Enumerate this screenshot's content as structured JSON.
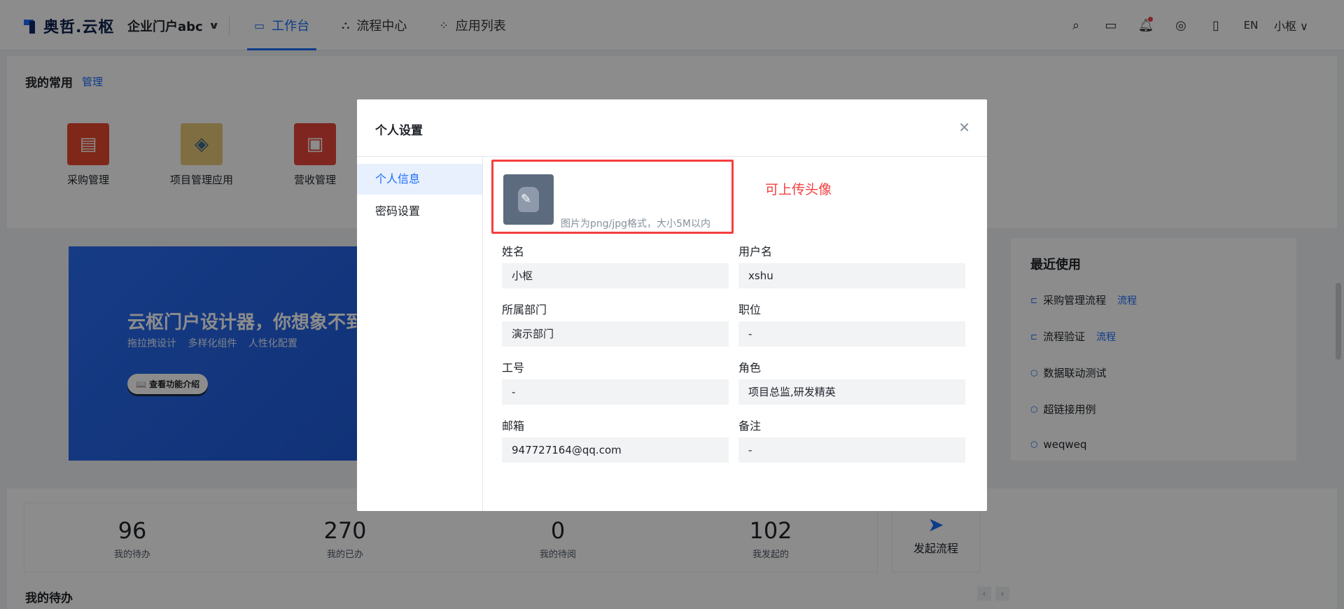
{
  "header": {
    "logo_text": "奥哲.云枢",
    "org_name": "企业门户abc",
    "nav": [
      {
        "label": "工作台",
        "icon": "monitor-icon",
        "active": true
      },
      {
        "label": "流程中心",
        "icon": "flow-icon",
        "active": false
      },
      {
        "label": "应用列表",
        "icon": "grid-icon",
        "active": false
      }
    ],
    "lang": "EN",
    "user_name": "小枢"
  },
  "favorites": {
    "title": "我的常用",
    "manage": "管理",
    "apps": [
      {
        "label": "采购管理",
        "color": "#e8472f"
      },
      {
        "label": "项目管理应用",
        "color": "#e9c87a"
      },
      {
        "label": "营收管理",
        "color": "#e6463a"
      }
    ]
  },
  "banner": {
    "title": "云枢门户设计器，你想象不到",
    "subtitle": "拖拉拽设计 多样化组件 人性化配置",
    "button": "📖 查看功能介绍"
  },
  "recent": {
    "title": "最近使用",
    "items": [
      {
        "label": "采购管理流程",
        "tag": "流程"
      },
      {
        "label": "流程验证",
        "tag": "流程"
      },
      {
        "label": "数据联动测试",
        "tag": ""
      },
      {
        "label": "超链接用例",
        "tag": ""
      },
      {
        "label": "weqweq",
        "tag": ""
      }
    ]
  },
  "stats": {
    "items": [
      {
        "value": "96",
        "label": "我的待办"
      },
      {
        "value": "270",
        "label": "我的已办"
      },
      {
        "value": "0",
        "label": "我的待阅"
      },
      {
        "value": "102",
        "label": "我发起的"
      }
    ],
    "start_label": "发起流程",
    "todo_title": "我的待办"
  },
  "modal": {
    "title": "个人设置",
    "menu": [
      {
        "label": "个人信息",
        "active": true
      },
      {
        "label": "密码设置",
        "active": false
      }
    ],
    "avatar_hint": "图片为png/jpg格式，大小5M以内",
    "upload_note": "可上传头像",
    "fields": {
      "name": {
        "label": "姓名",
        "value": "小枢"
      },
      "username": {
        "label": "用户名",
        "value": "xshu"
      },
      "dept": {
        "label": "所属部门",
        "value": "演示部门"
      },
      "position": {
        "label": "职位",
        "value": "-"
      },
      "job_no": {
        "label": "工号",
        "value": "-"
      },
      "role": {
        "label": "角色",
        "value": "项目总监,研发精英"
      },
      "email": {
        "label": "邮箱",
        "value": "947727164@qq.com"
      },
      "remark": {
        "label": "备注",
        "value": "-"
      }
    }
  },
  "colors": {
    "accent": "#1a6dfb",
    "danger": "#f53f3f"
  }
}
